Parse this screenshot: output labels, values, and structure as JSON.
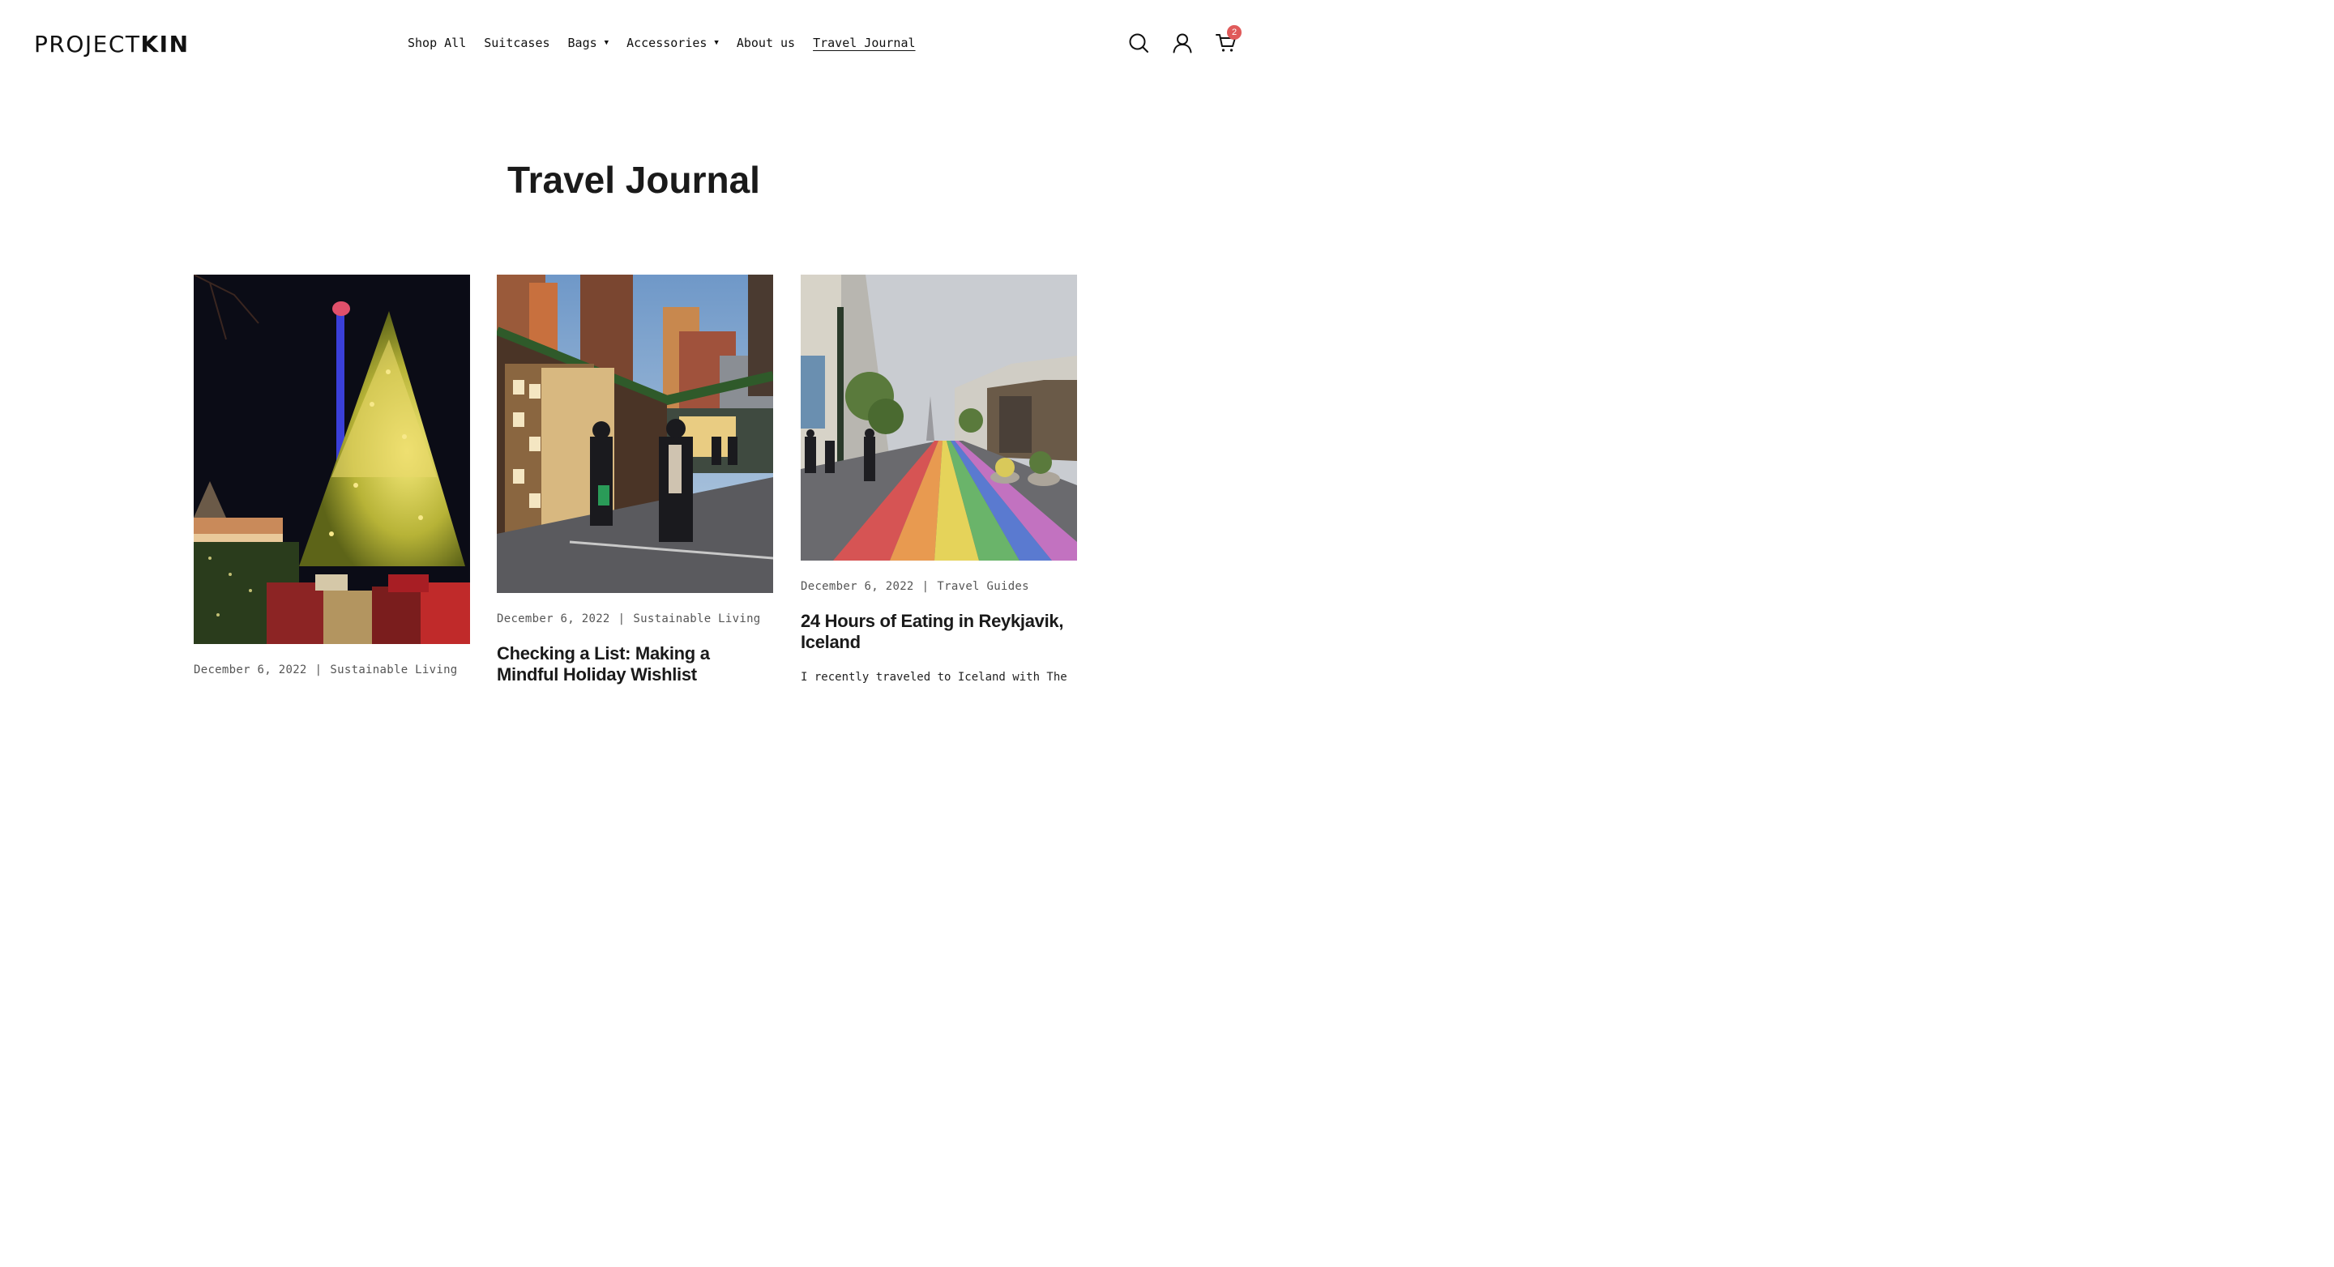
{
  "header": {
    "logo": {
      "light": "PROJECT",
      "bold": "KIN"
    },
    "nav": [
      {
        "label": "Shop All",
        "dropdown": false,
        "active": false
      },
      {
        "label": "Suitcases",
        "dropdown": false,
        "active": false
      },
      {
        "label": "Bags",
        "dropdown": true,
        "active": false
      },
      {
        "label": "Accessories",
        "dropdown": true,
        "active": false
      },
      {
        "label": "About us",
        "dropdown": false,
        "active": false
      },
      {
        "label": "Travel Journal",
        "dropdown": false,
        "active": true
      }
    ],
    "icons": [
      "search-icon",
      "account-icon",
      "cart-icon"
    ],
    "cart_count": "2",
    "badge_color": "#e05a5a"
  },
  "page": {
    "title": "Travel Journal"
  },
  "posts": [
    {
      "date": "December 6, 2022",
      "separator": "|",
      "category": "Sustainable Living",
      "title": "",
      "excerpt": "",
      "image": "christmas-tree-night-photo"
    },
    {
      "date": "December 6, 2022",
      "separator": "|",
      "category": "Sustainable Living",
      "title": "Checking a List: Making a Mindful Holiday Wishlist",
      "excerpt": "",
      "image": "holiday-market-street-photo"
    },
    {
      "date": "December 6, 2022",
      "separator": "|",
      "category": "Travel Guides",
      "title": "24 Hours of Eating in Reykjavik, Iceland",
      "excerpt": "I recently traveled to Iceland with The",
      "image": "rainbow-street-reykjavik-photo"
    }
  ]
}
